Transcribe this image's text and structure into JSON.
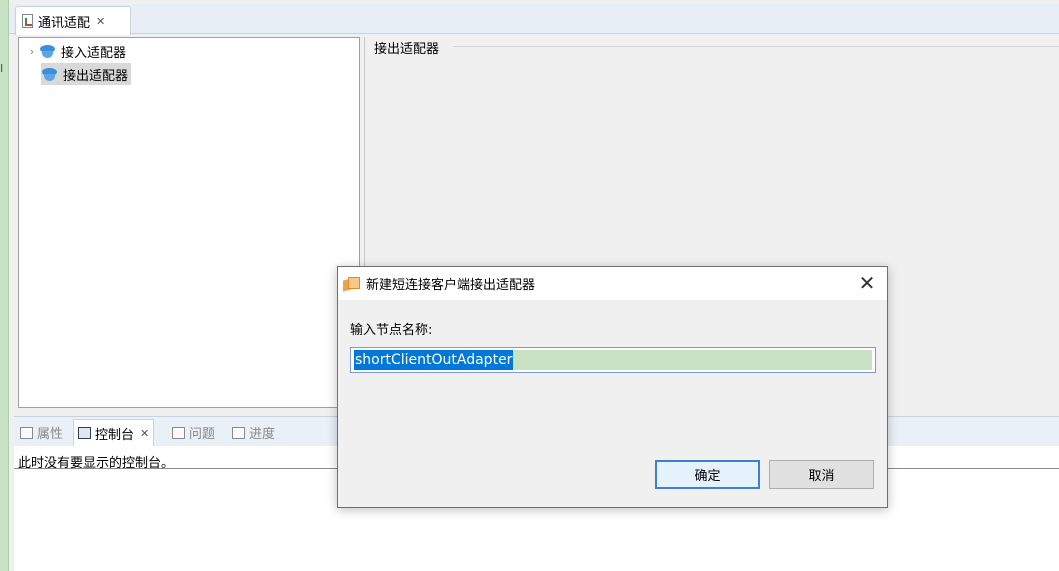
{
  "editor_tab": {
    "label": "通讯适配",
    "close": "✕"
  },
  "tree": {
    "items": [
      {
        "label": "接入适配器",
        "expand": "›"
      },
      {
        "label": "接出适配器"
      }
    ]
  },
  "detail": {
    "group_title": "接出适配器"
  },
  "bottom_tabs": [
    {
      "label": "属性"
    },
    {
      "label": "控制台",
      "close": "✕"
    },
    {
      "label": "问题"
    },
    {
      "label": "进度"
    }
  ],
  "console": {
    "message": "此时没有要显示的控制台。"
  },
  "dialog": {
    "title": "新建短连接客户端接出适配器",
    "close": "✕",
    "field_label": "输入节点名称:",
    "input_value": "shortClientOutAdapter",
    "ok_label": "确定",
    "cancel_label": "取消"
  },
  "left_strip": {
    "marker": "I"
  }
}
